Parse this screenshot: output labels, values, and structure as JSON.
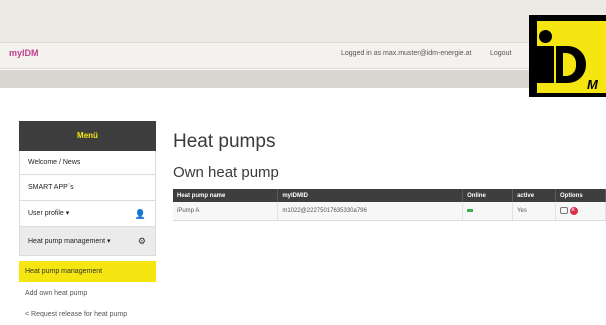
{
  "header": {
    "brand": "myIDM",
    "logged_in_text": "Logged in as max.muster@idm-energie.at",
    "logout_label": "Logout",
    "logo_letters": "iDM"
  },
  "sidebar": {
    "title": "Menü",
    "items": [
      {
        "label": "Welcome / News",
        "icon": null
      },
      {
        "label": "SMART APP´s",
        "icon": null
      },
      {
        "label": "User profile ▾",
        "icon": "user-icon"
      },
      {
        "label": "Heat pump management ▾",
        "icon": "gear-icon"
      }
    ],
    "submenu": {
      "active": "Heat pump management",
      "items": [
        "Add own heat pump",
        "< Request release for heat pump"
      ]
    }
  },
  "main": {
    "title": "Heat pumps",
    "subtitle": "Own heat pump",
    "table": {
      "columns": [
        "Heat pump name",
        "myIDMID",
        "Online",
        "active",
        "Options"
      ],
      "rows": [
        {
          "name": "iPump A",
          "myidmid": "m1022@22275017635330a796",
          "online": "green",
          "active": "Yes"
        }
      ]
    }
  },
  "colors": {
    "accent_yellow": "#f5e611",
    "dark_header": "#3e3e3e",
    "brand_pink": "#c0408e",
    "online_green": "#37b24d",
    "delete_red": "#d9304a"
  }
}
